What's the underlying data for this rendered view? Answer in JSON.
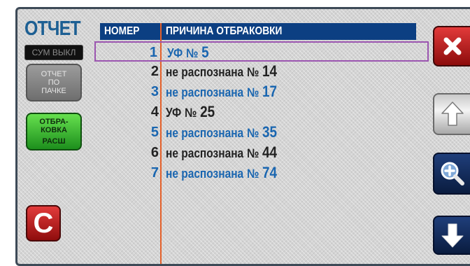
{
  "header": {
    "title": "ОТЧЕТ",
    "sum_status": "СУМ ВЫКЛ"
  },
  "side_buttons": {
    "pack_report": [
      "ОТЧЕТ",
      "ПО",
      "ПАЧКЕ"
    ],
    "culling_ext": [
      "ОТБРА-",
      "КОВКА",
      "РАСШ"
    ],
    "clear_label": "C"
  },
  "table": {
    "col_number": "НОМЕР",
    "col_reason": "ПРИЧИНА ОТБРАКОВКИ",
    "rows": [
      {
        "num": "1",
        "reason": "УФ",
        "sign": "№",
        "value": "5"
      },
      {
        "num": "2",
        "reason": "не распознана",
        "sign": "№",
        "value": "14"
      },
      {
        "num": "3",
        "reason": "не распознана",
        "sign": "№",
        "value": "17"
      },
      {
        "num": "4",
        "reason": "УФ",
        "sign": "№",
        "value": "25"
      },
      {
        "num": "5",
        "reason": "не распознана",
        "sign": "№",
        "value": "35"
      },
      {
        "num": "6",
        "reason": "не распознана",
        "sign": "№",
        "value": "44"
      },
      {
        "num": "7",
        "reason": "не распознана",
        "sign": "№",
        "value": "74"
      }
    ]
  },
  "icons": {
    "close": "close-icon",
    "up": "arrow-up-icon",
    "zoom": "zoom-in-icon",
    "down": "arrow-down-icon"
  },
  "colors": {
    "accent_blue": "#1a66b0",
    "header_bar": "#0c3f82",
    "divider": "#e4602a",
    "selection": "#9b55b0",
    "red_button": "#c41f1f"
  }
}
